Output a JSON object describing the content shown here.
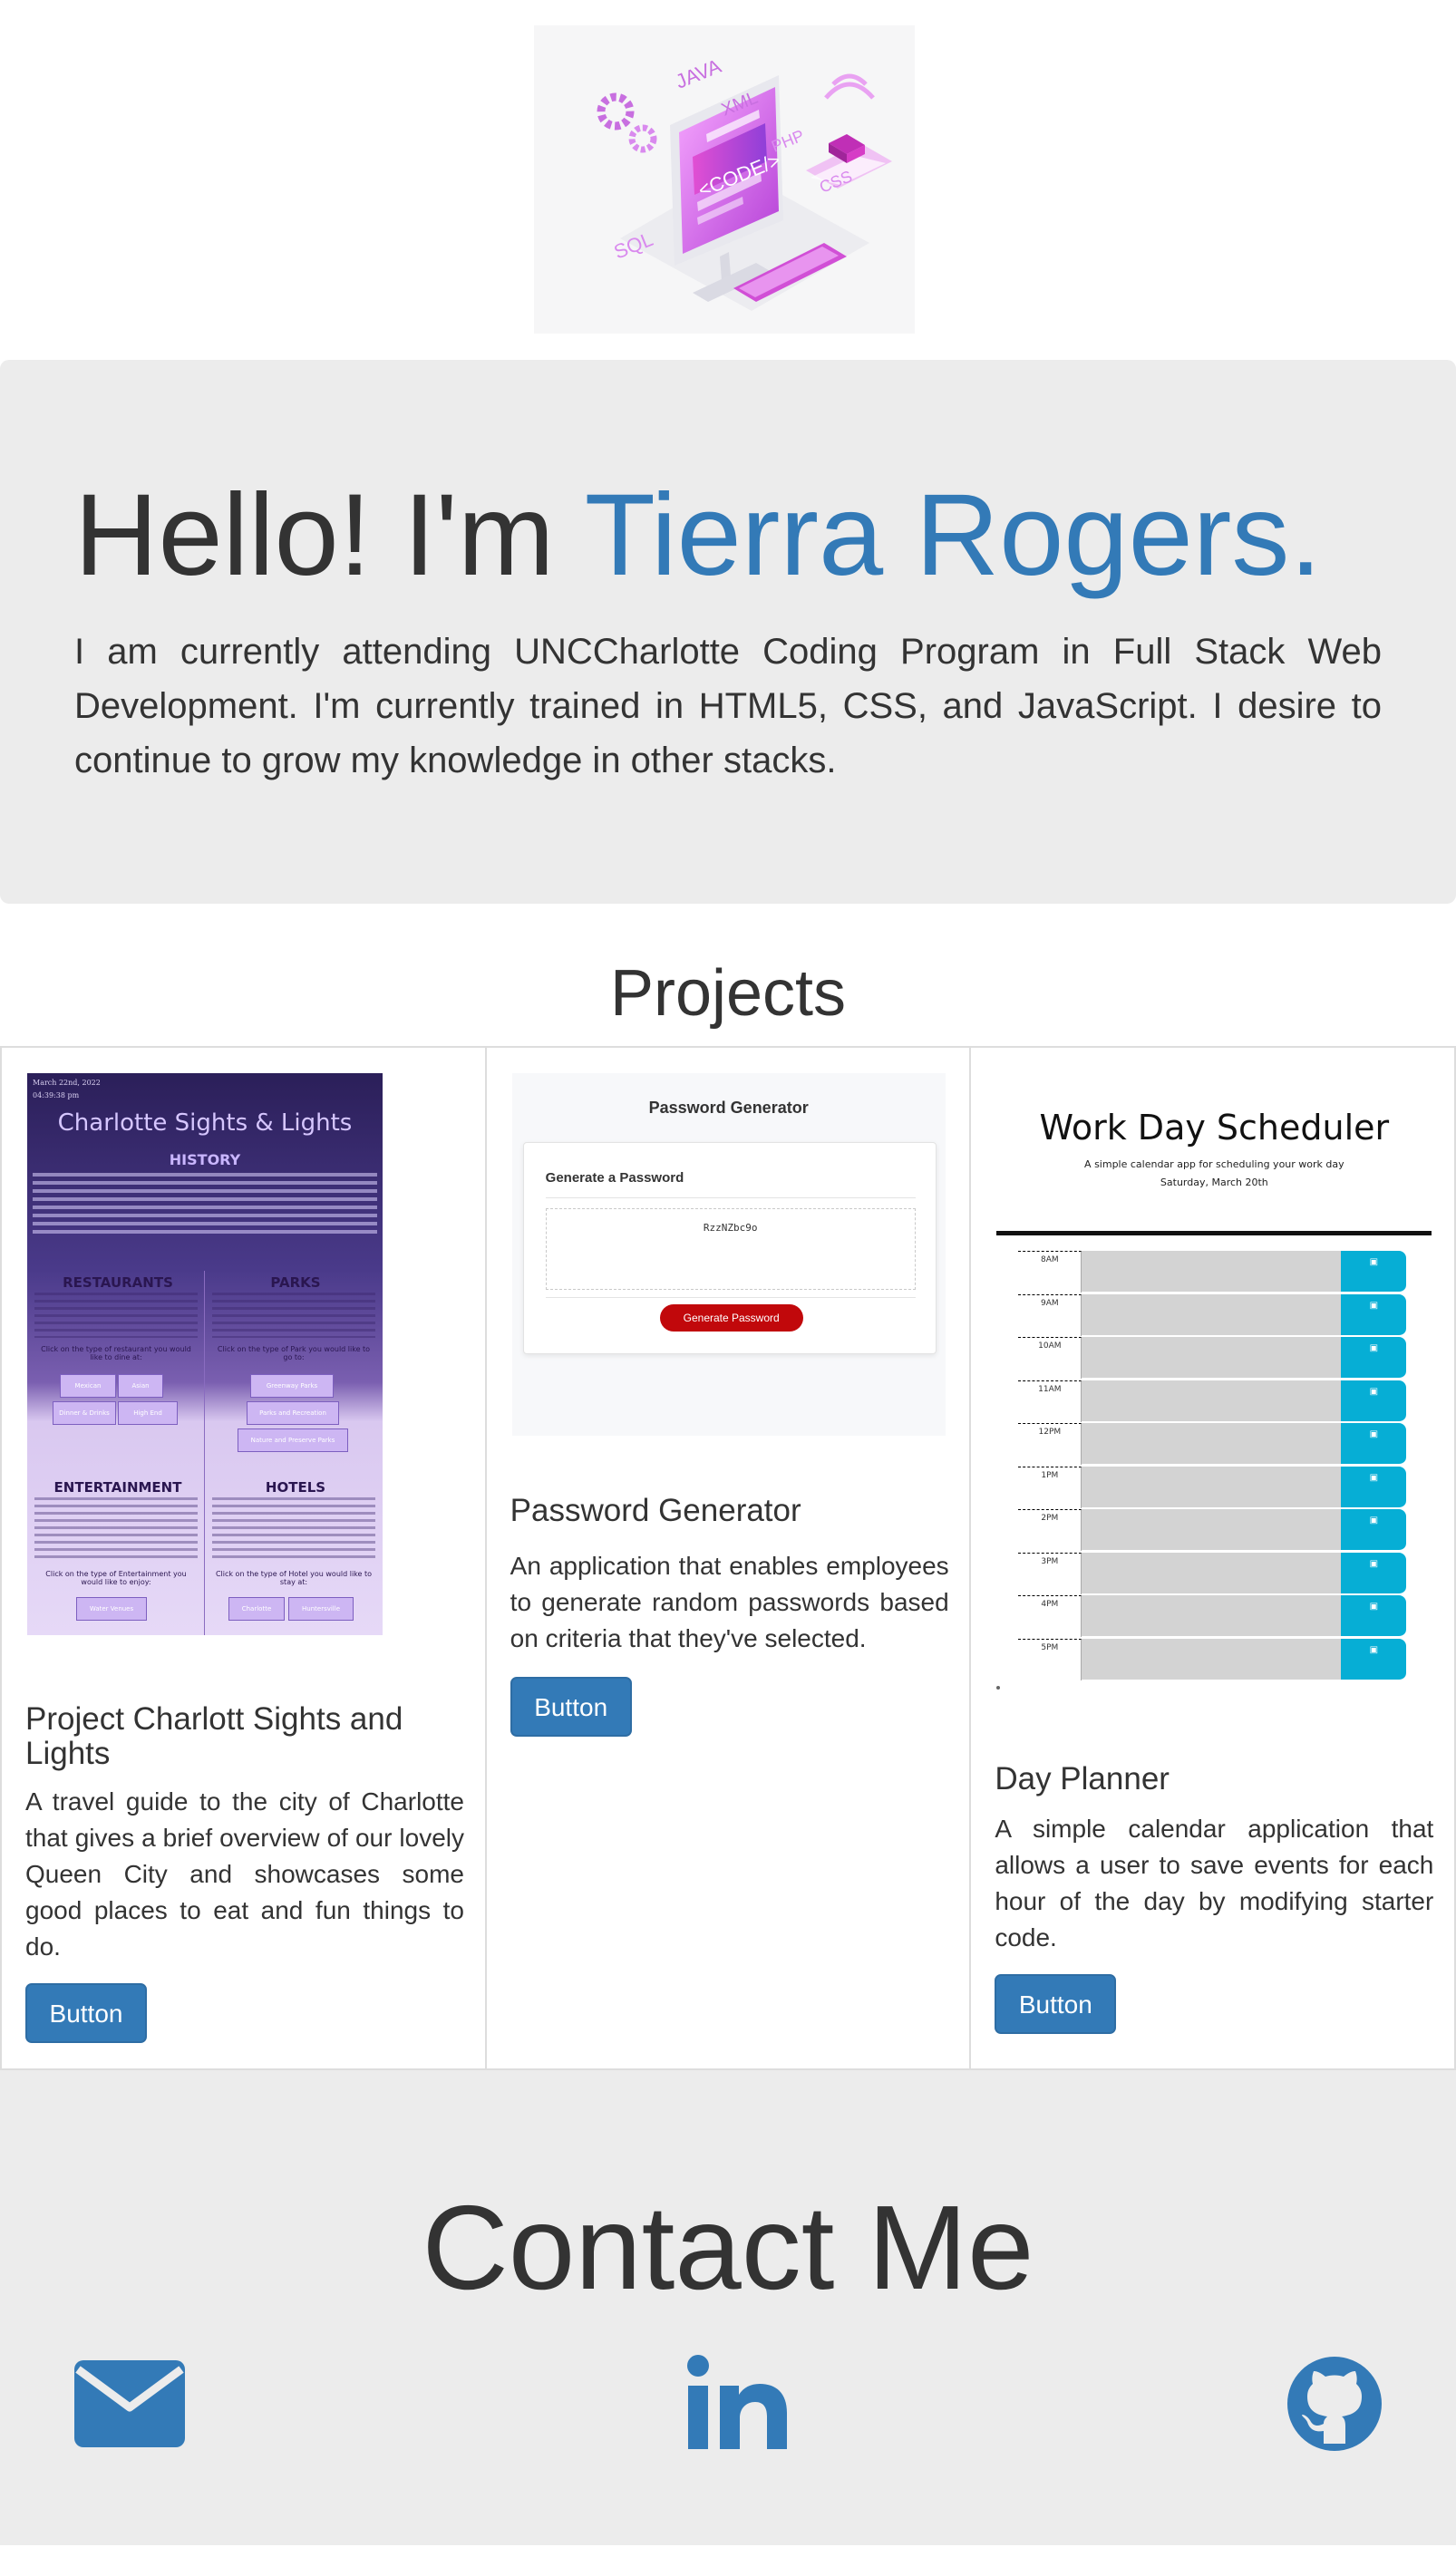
{
  "colors": {
    "accent": "#337ab7",
    "jumbotron_bg": "#ececec",
    "text": "#333333",
    "button": "#337ab7"
  },
  "hero": {
    "image_icon": "coding-illustration",
    "illustration_labels": {
      "java": "JAVA",
      "xml": "XML",
      "php": "PHP",
      "code": "<CODE/>",
      "sql": "SQL",
      "css": "CSS"
    }
  },
  "jumbotron": {
    "greeting": "Hello! I'm ",
    "name": "Tierra Rogers.",
    "intro": "I am currently attending UNCCharlotte Coding Program in Full Stack Web Development. I'm currently trained in HTML5, CSS, and JavaScript. I desire to continue to grow my knowledge in other stacks."
  },
  "projects": {
    "heading": "Projects",
    "items": [
      {
        "title": "Project Charlott Sights and Lights",
        "description": "A travel guide to the city of Charlotte that gives a brief overview of our lovely Queen City and showcases some good places to eat and fun things to do.",
        "button": "Button",
        "screenshot": {
          "date": "March 22nd, 2022",
          "time": "04:39:38 pm",
          "title": "Charlotte Sights & Lights",
          "history": "HISTORY",
          "restaurants": "RESTAURANTS",
          "parks": "PARKS",
          "entertainment": "ENTERTAINMENT",
          "hotels": "HOTELS",
          "restaurant_buttons": [
            "Mexican",
            "Asian",
            "Dinner & Drinks",
            "High End"
          ],
          "park_buttons": [
            "Greenway Parks",
            "Parks and Recreation",
            "Nature and Preserve Parks"
          ],
          "entertainment_buttons": [
            "Water Venues"
          ],
          "hotel_buttons": [
            "Charlotte",
            "Huntersville"
          ],
          "restaurants_prompt": "Click on the type of restaurant you would like to dine at:",
          "parks_prompt": "Click on the type of Park you would like to go to:",
          "entertainment_prompt": "Click on the type of Entertainment you would like to enjoy:",
          "hotels_prompt": "Click on the type of Hotel you would like to stay at:"
        }
      },
      {
        "title": "Password Generator",
        "description": "An application that enables employees to generate random passwords based on criteria that they've selected.",
        "button": "Button",
        "screenshot": {
          "heading": "Password Generator",
          "card_title": "Generate a Password",
          "password": "RzzNZbc9o",
          "button": "Generate Password"
        }
      },
      {
        "title": "Day Planner",
        "description": "A simple calendar application that allows a user to save events for each hour of the day by modifying starter code.",
        "button": "Button",
        "screenshot": {
          "title": "Work Day Scheduler",
          "subtitle": "A simple calendar app for scheduling your work day",
          "date": "Saturday, March 20th",
          "hours": [
            "8AM",
            "9AM",
            "10AM",
            "11AM",
            "12PM",
            "1PM",
            "2PM",
            "3PM",
            "4PM",
            "5PM"
          ]
        }
      }
    ]
  },
  "contact": {
    "heading": "Contact Me",
    "icons": {
      "email": "envelope-icon",
      "linkedin": "linkedin-icon",
      "github": "github-icon"
    }
  }
}
